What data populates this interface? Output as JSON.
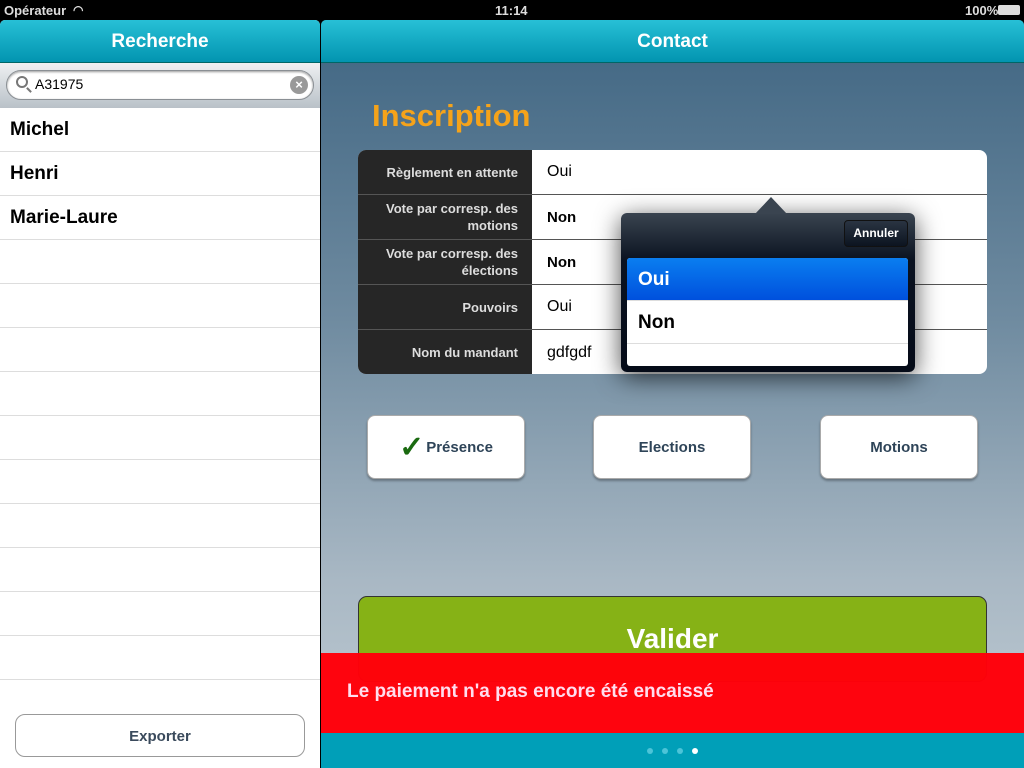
{
  "status": {
    "carrier": "Opérateur",
    "time": "11:14",
    "battery": "100%"
  },
  "left": {
    "title": "Recherche",
    "search_value": "A31975",
    "items": [
      "Michel",
      "Henri",
      "Marie-Laure"
    ],
    "export_label": "Exporter"
  },
  "right": {
    "title": "Contact",
    "section_title": "Inscription",
    "rows": [
      {
        "label": "Règlement en attente",
        "value": "Oui"
      },
      {
        "label": "Vote par corresp. des motions",
        "value": "Non"
      },
      {
        "label": "Vote par corresp. des élections",
        "value": "Non"
      },
      {
        "label": "Pouvoirs",
        "value": "Oui"
      },
      {
        "label": "Nom du mandant",
        "value": "gdfgdf"
      }
    ],
    "picker": {
      "cancel_label": "Annuler",
      "options": [
        "Oui",
        "Non"
      ],
      "selected": "Oui"
    },
    "buttons": {
      "presence": "Présence",
      "elections": "Elections",
      "motions": "Motions"
    },
    "validate_label": "Valider",
    "alert": "Le paiement n'a pas encore été encaissé",
    "page_indicator": {
      "pages": 4,
      "current": 4
    }
  },
  "colors": {
    "header": "#0294b0",
    "accent_title": "#f5a31a",
    "validate": "#86b216",
    "alert": "#ff000a",
    "selected": "#0a7ef0"
  }
}
